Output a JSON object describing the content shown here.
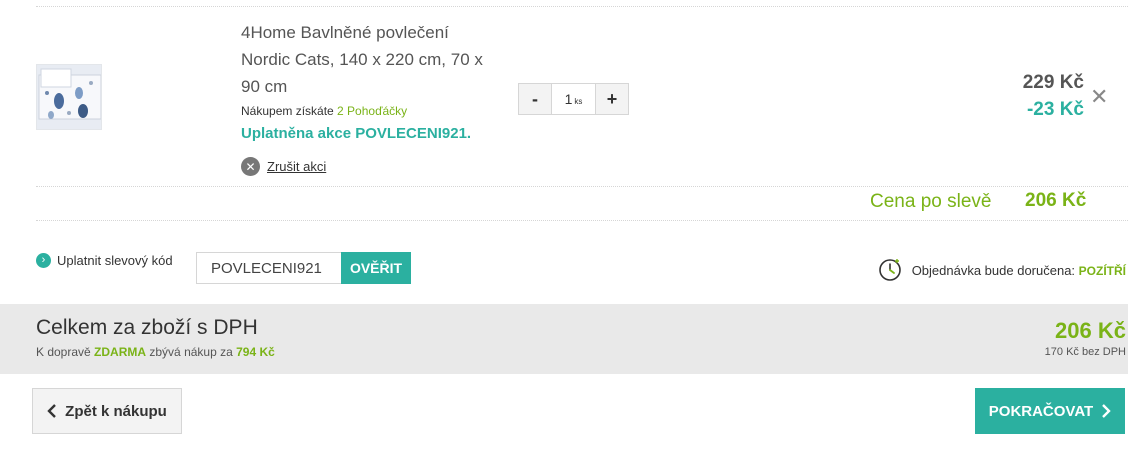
{
  "product": {
    "name": "4Home Bavlněné povlečení Nordic Cats, 140 x 220 cm, 70 x 90 cm",
    "bonus_prefix": "Nákupem získáte ",
    "bonus_value": "2 Pohoďáčky",
    "applied_promo": "Uplatněna akce POVLECENI921.",
    "cancel_promo": "Zrušit akci",
    "quantity": "1",
    "quantity_unit": "ks",
    "price": "229 Kč",
    "discount": "-23 Kč",
    "minus_label": "-",
    "plus_label": "+"
  },
  "after_discount": {
    "label": "Cena po slevě",
    "value": "206 Kč"
  },
  "coupon": {
    "label": "Uplatnit slevový kód",
    "value": "POVLECENI921",
    "button": "OVĚŘIT"
  },
  "delivery": {
    "label": "Objednávka bude doručena: ",
    "value": "POZÍTŘÍ"
  },
  "total": {
    "title": "Celkem za zboží s DPH",
    "shipping_prefix": "K dopravě ",
    "shipping_free": "ZDARMA",
    "shipping_middle": " zbývá nákup za ",
    "shipping_remaining": "794 Kč",
    "sum": "206 Kč",
    "without_vat": "170 Kč bez DPH"
  },
  "nav": {
    "back": "Zpět k nákupu",
    "next": "POKRAČOVAT"
  },
  "icons": {
    "remove": "close-icon",
    "cancel": "close-circle-icon",
    "coupon": "chevron-right-circle-icon",
    "delivery": "clock-icon",
    "back": "chevron-left-icon",
    "next": "chevron-right-icon"
  },
  "colors": {
    "accent_teal": "#2bb0a0",
    "accent_green": "#7ab317",
    "bar_gray": "#e9e9e9"
  }
}
